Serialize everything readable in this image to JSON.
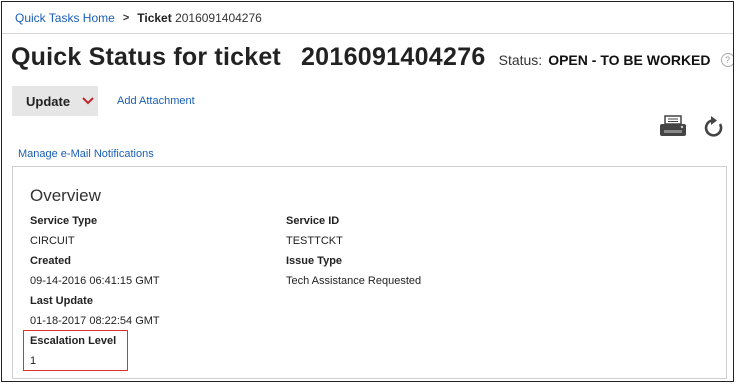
{
  "breadcrumb": {
    "home": "Quick Tasks Home",
    "separator": ">",
    "current_label": "Ticket",
    "current_number": "2016091404276"
  },
  "header": {
    "title": "Quick Status for ticket",
    "ticket_number": "2016091404276",
    "status_label": "Status:",
    "status_value": "OPEN - TO BE WORKED",
    "help_glyph": "?"
  },
  "toolbar": {
    "update_label": "Update",
    "add_attachment_label": "Add Attachment",
    "print_icon": "printer-icon",
    "refresh_icon": "refresh-icon"
  },
  "manage_notifications_label": "Manage e-Mail Notifications",
  "overview": {
    "title": "Overview",
    "service_type_label": "Service Type",
    "service_type_value": "CIRCUIT",
    "service_id_label": "Service ID",
    "service_id_value": "TESTTCKT",
    "created_label": "Created",
    "created_value": "09-14-2016 06:41:15 GMT",
    "issue_type_label": "Issue Type",
    "issue_type_value": "Tech Assistance Requested",
    "last_update_label": "Last Update",
    "last_update_value": "01-18-2017 08:22:54 GMT",
    "escalation_label": "Escalation Level",
    "escalation_value": "1"
  },
  "colors": {
    "link": "#1a5fb4",
    "highlight_border": "#d9342b",
    "chevron": "#c0262c"
  }
}
